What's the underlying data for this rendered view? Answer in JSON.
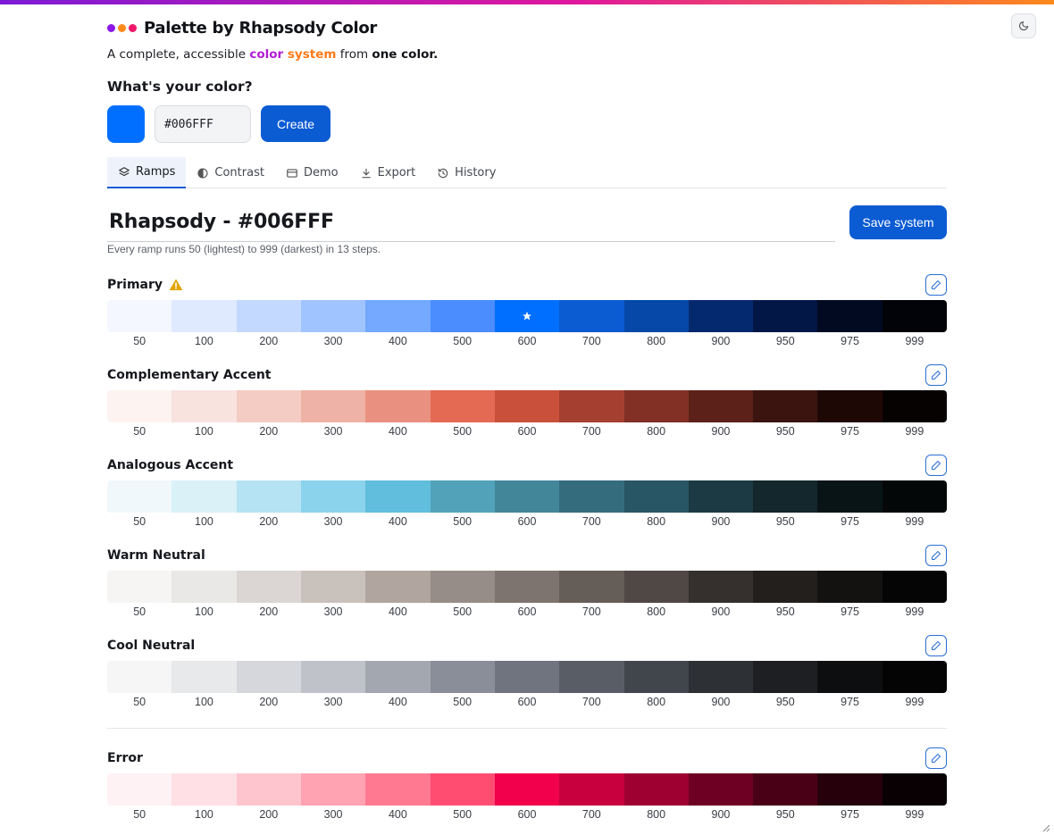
{
  "app": {
    "title": "Palette by Rhapsody Color",
    "dot_colors": [
      "#8a17e6",
      "#ff8a1c",
      "#f0166a"
    ],
    "theme_toggle_icon": "moon-icon"
  },
  "tagline": {
    "part1": "A complete, accessible ",
    "color_word": "color",
    "system_word": " system",
    "part2": " from ",
    "strong": "one color."
  },
  "color_picker": {
    "question": "What's your color?",
    "swatch_color": "#006FFF",
    "hex_value": "#006FFF",
    "create_label": "Create"
  },
  "tabs": [
    {
      "label": "Ramps",
      "icon": "layers-icon",
      "active": true
    },
    {
      "label": "Contrast",
      "icon": "contrast-icon",
      "active": false
    },
    {
      "label": "Demo",
      "icon": "window-icon",
      "active": false
    },
    {
      "label": "Export",
      "icon": "download-icon",
      "active": false
    },
    {
      "label": "History",
      "icon": "history-icon",
      "active": false
    }
  ],
  "system": {
    "name": "Rhapsody - #006FFF",
    "save_label": "Save system",
    "subtitle": "Every ramp runs 50 (lightest) to 999 (darkest) in 13 steps."
  },
  "accent_color": "#0b5bd3",
  "steps": [
    "50",
    "100",
    "200",
    "300",
    "400",
    "500",
    "600",
    "700",
    "800",
    "900",
    "950",
    "975",
    "999"
  ],
  "ramps": [
    {
      "name": "Primary",
      "warning": true,
      "base_step": "600",
      "colors": [
        "#f4f7ff",
        "#dfe9ff",
        "#c4d9ff",
        "#a0c4ff",
        "#75a8ff",
        "#4b8cff",
        "#006fff",
        "#0b5bd3",
        "#0548a8",
        "#04296e",
        "#031747",
        "#020a22",
        "#010308"
      ]
    },
    {
      "name": "Complementary Accent",
      "warning": false,
      "base_step": "",
      "colors": [
        "#fdf4f2",
        "#f8e3df",
        "#f4ccc4",
        "#efb2a6",
        "#ea9080",
        "#e46a54",
        "#c9503a",
        "#a54030",
        "#823025",
        "#5c2119",
        "#3b1410",
        "#1e0806",
        "#070202"
      ]
    },
    {
      "name": "Analogous Accent",
      "warning": false,
      "base_step": "",
      "colors": [
        "#f1f8fc",
        "#daf1f8",
        "#b5e3f3",
        "#8bd3ec",
        "#61bedd",
        "#52a3ba",
        "#42869a",
        "#356c7d",
        "#295664",
        "#1c3a43",
        "#13272c",
        "#081416",
        "#040708"
      ]
    },
    {
      "name": "Warm Neutral",
      "warning": false,
      "base_step": "",
      "colors": [
        "#f6f5f4",
        "#eae8e6",
        "#dbd6d3",
        "#c9c1bc",
        "#b0a69f",
        "#978d88",
        "#7e746f",
        "#655d58",
        "#4f4845",
        "#35302d",
        "#231f1d",
        "#141210",
        "#060505"
      ]
    },
    {
      "name": "Cool Neutral",
      "warning": false,
      "base_step": "",
      "colors": [
        "#f6f6f7",
        "#e8e9eb",
        "#d5d7dc",
        "#bfc2c9",
        "#a3a8b0",
        "#898e99",
        "#6f747e",
        "#585d66",
        "#41454c",
        "#2d3035",
        "#1d1f23",
        "#0d0e10",
        "#040404"
      ]
    },
    {
      "name": "Error",
      "warning": false,
      "base_step": "",
      "colors": [
        "#fff2f4",
        "#ffe0e5",
        "#ffc5ce",
        "#ffa2b1",
        "#ff7a91",
        "#ff4d72",
        "#f2004c",
        "#c8003e",
        "#9e0032",
        "#6e0023",
        "#490017",
        "#26000b",
        "#080003"
      ]
    }
  ]
}
